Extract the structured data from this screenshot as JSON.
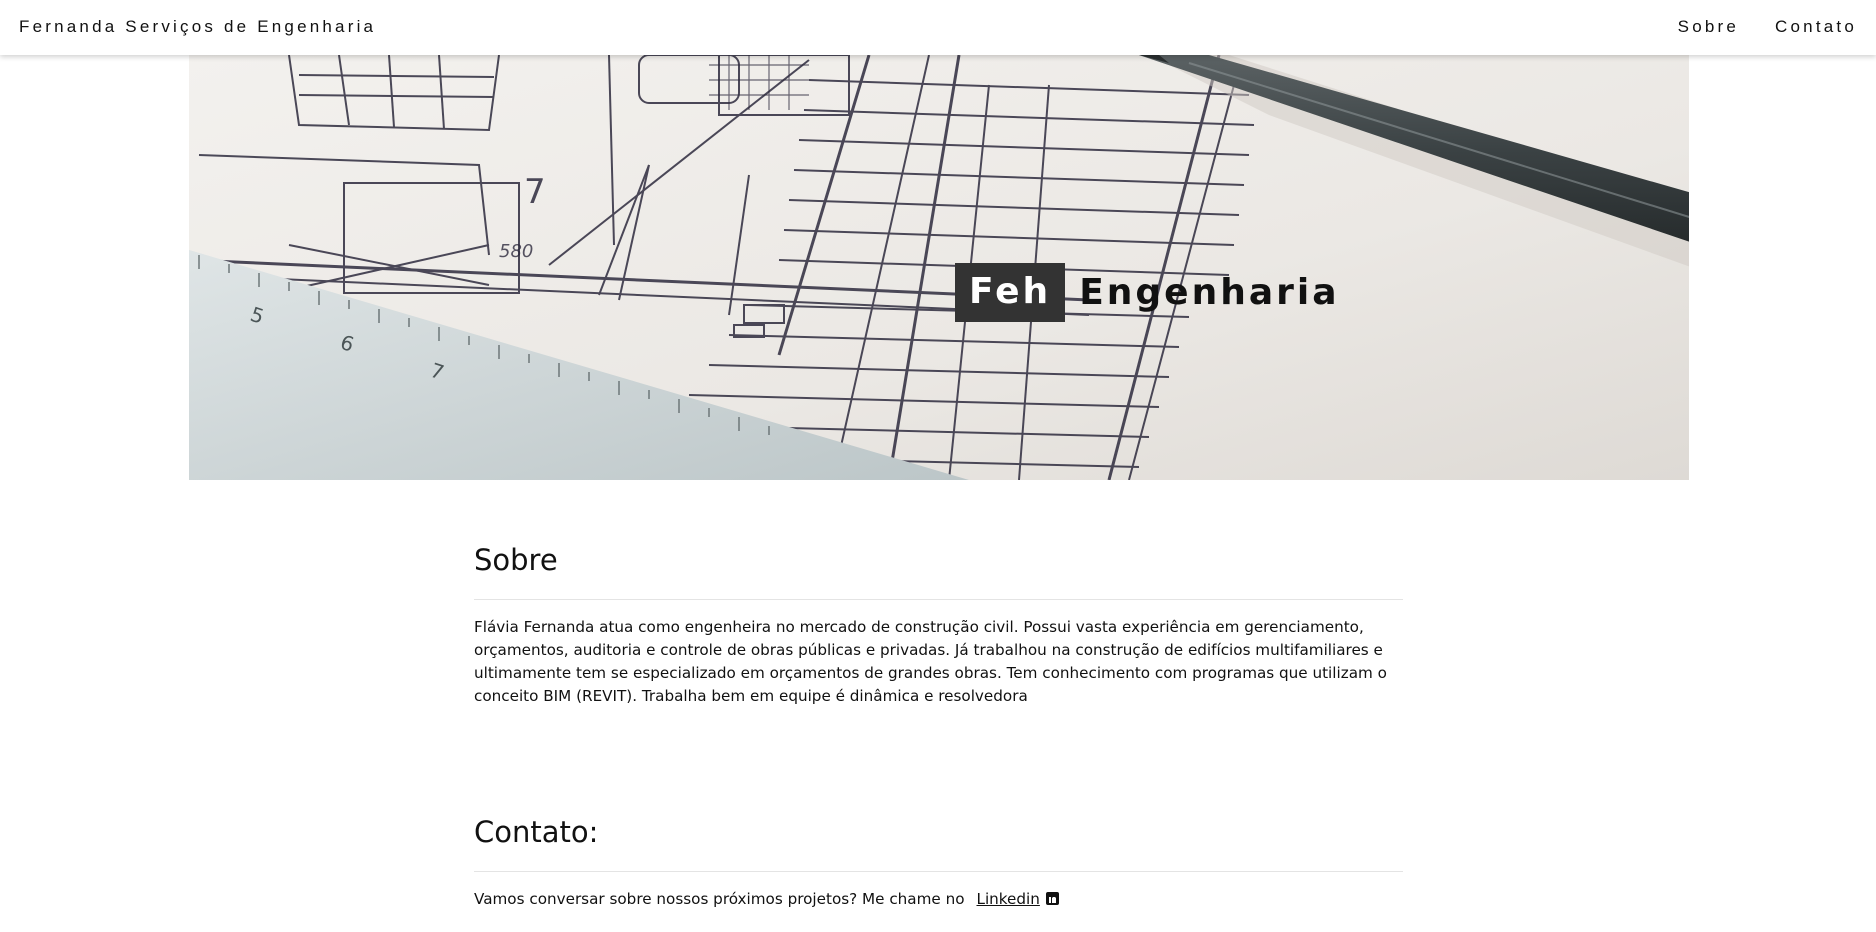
{
  "header": {
    "brand": "Fernanda Serviços de Engenharia",
    "nav": [
      {
        "label": "Sobre"
      },
      {
        "label": "Contato"
      }
    ]
  },
  "hero": {
    "title_boxed": "Feh",
    "title_rest": "Engenharia",
    "plan_numbers": [
      "7",
      "580",
      "5",
      "6",
      "7"
    ]
  },
  "sobre": {
    "heading": "Sobre",
    "text": "Flávia Fernanda atua como engenheira no mercado de construção civil. Possui vasta experiência em gerenciamento, orçamentos, auditoria e controle de obras públicas e privadas. Já trabalhou na construção de edifícios multifamiliares e ultimamente tem se especializado em orçamentos de grandes obras. Tem conhecimento com programas que utilizam o conceito BIM (REVIT). Trabalha bem em equipe é dinâmica e resolvedora"
  },
  "contato": {
    "heading": "Contato:",
    "text": "Vamos conversar sobre nossos próximos projetos? Me chame no",
    "link_label": "Linkedin",
    "icon": "linkedin-icon"
  },
  "colors": {
    "title_box": "#333333",
    "text": "#111111",
    "divider": "#e4e4e4"
  }
}
